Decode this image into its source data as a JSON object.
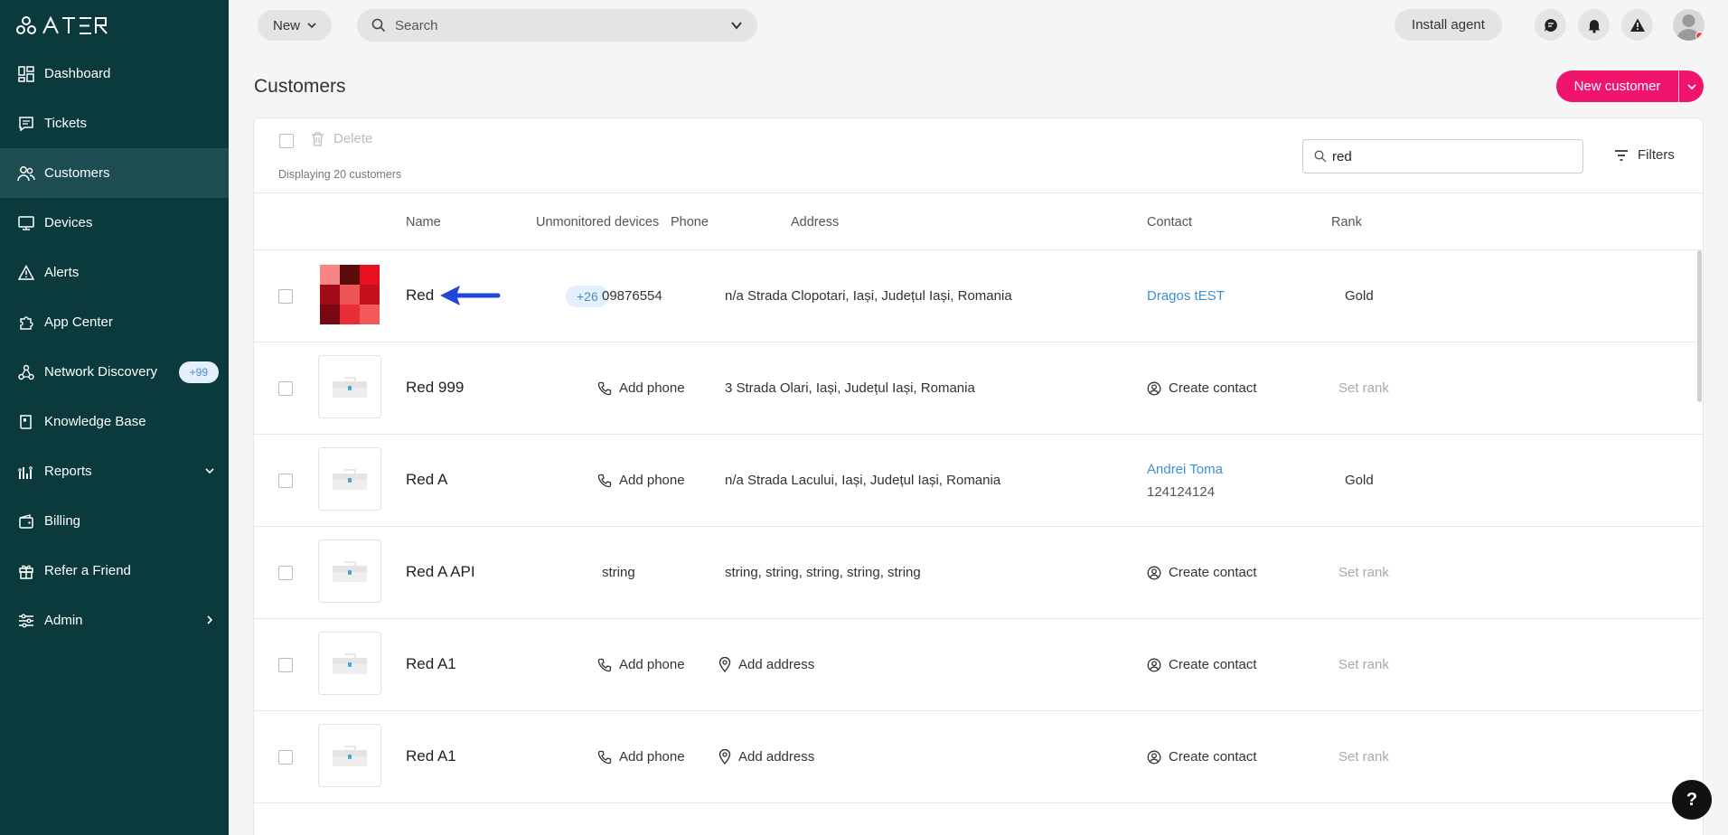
{
  "app": {
    "logo_text": "ATERA"
  },
  "sidebar": {
    "items": [
      {
        "label": "Dashboard",
        "icon": "dashboard-icon"
      },
      {
        "label": "Tickets",
        "icon": "ticket-icon"
      },
      {
        "label": "Customers",
        "icon": "customers-icon",
        "active": true
      },
      {
        "label": "Devices",
        "icon": "monitor-icon"
      },
      {
        "label": "Alerts",
        "icon": "alert-icon"
      },
      {
        "label": "App Center",
        "icon": "puzzle-icon"
      },
      {
        "label": "Network Discovery",
        "icon": "network-icon",
        "badge": "+99"
      },
      {
        "label": "Knowledge Base",
        "icon": "book-icon"
      },
      {
        "label": "Reports",
        "icon": "reports-icon"
      },
      {
        "label": "Billing",
        "icon": "wallet-icon"
      },
      {
        "label": "Refer a Friend",
        "icon": "gift-icon"
      },
      {
        "label": "Admin",
        "icon": "sliders-icon"
      }
    ]
  },
  "topbar": {
    "new_label": "New",
    "search_placeholder": "Search",
    "install_label": "Install agent"
  },
  "page": {
    "title": "Customers",
    "new_customer_label": "New customer"
  },
  "toolbar": {
    "delete_label": "Delete",
    "displaying": "Displaying 20 customers",
    "filter_value": "red",
    "filters_label": "Filters"
  },
  "table": {
    "headers": [
      "Name",
      "Unmonitored devices",
      "Phone",
      "Address",
      "Contact",
      "Rank"
    ],
    "rows": [
      {
        "name": "Red",
        "devices": "+26",
        "phone": "09876554",
        "phone_is_action": false,
        "address": "n/a Strada Clopotari, Iași, Județul Iași, Romania",
        "address_is_action": false,
        "contact": "Dragos tEST",
        "contact_phone": "",
        "contact_is_action": false,
        "rank": "Gold",
        "rank_is_action": false
      },
      {
        "name": "Red 999",
        "devices": "",
        "phone": "Add phone",
        "phone_is_action": true,
        "address": "3 Strada Olari, Iași, Județul Iași, Romania",
        "address_is_action": false,
        "contact": "Create contact",
        "contact_phone": "",
        "contact_is_action": true,
        "rank": "Set rank",
        "rank_is_action": true
      },
      {
        "name": "Red A",
        "devices": "",
        "phone": "Add phone",
        "phone_is_action": true,
        "address": "n/a Strada Lacului, Iași, Județul Iași, Romania",
        "address_is_action": false,
        "contact": "Andrei Toma",
        "contact_phone": "124124124",
        "contact_is_action": false,
        "rank": "Gold",
        "rank_is_action": false
      },
      {
        "name": "Red A API",
        "devices": "",
        "phone": "string",
        "phone_is_action": false,
        "address": "string, string, string, string, string",
        "address_is_action": false,
        "contact": "Create contact",
        "contact_phone": "",
        "contact_is_action": true,
        "rank": "Set rank",
        "rank_is_action": true
      },
      {
        "name": "Red A1",
        "devices": "",
        "phone": "Add phone",
        "phone_is_action": true,
        "address": "Add address",
        "address_is_action": true,
        "contact": "Create contact",
        "contact_phone": "",
        "contact_is_action": true,
        "rank": "Set rank",
        "rank_is_action": true
      },
      {
        "name": "Red A1",
        "devices": "",
        "phone": "Add phone",
        "phone_is_action": true,
        "address": "Add address",
        "address_is_action": true,
        "contact": "Create contact",
        "contact_phone": "",
        "contact_is_action": true,
        "rank": "Set rank",
        "rank_is_action": true
      }
    ]
  },
  "colors": {
    "sidebar_bg": "#0b3a3c",
    "accent": "#f0146c",
    "link": "#3d8ed6",
    "annotation_arrow": "#2346d9"
  },
  "help_label": "?"
}
